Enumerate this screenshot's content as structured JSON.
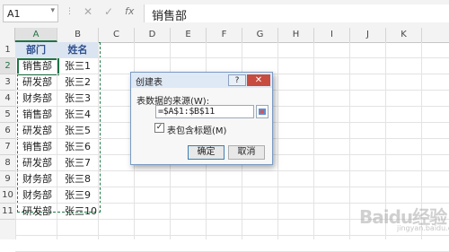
{
  "formula_bar": {
    "name_box": "A1",
    "name_box_arrow": "▾",
    "separator": "⋮",
    "cancel_symbol": "✕",
    "enter_symbol": "✓",
    "fx_label": "fx",
    "formula": "销售部"
  },
  "sheet": {
    "columns": [
      "A",
      "B",
      "C",
      "D",
      "E",
      "F",
      "G",
      "H",
      "I",
      "J",
      "K"
    ],
    "selected_column": "A",
    "rows": [
      "1",
      "2",
      "3",
      "4",
      "5",
      "6",
      "7",
      "8",
      "9",
      "10",
      "11"
    ],
    "selected_row": "2",
    "table_header": [
      "部门",
      "姓名"
    ],
    "table_rows": [
      [
        "销售部",
        "张三1"
      ],
      [
        "研发部",
        "张三2"
      ],
      [
        "财务部",
        "张三3"
      ],
      [
        "销售部",
        "张三4"
      ],
      [
        "研发部",
        "张三5"
      ],
      [
        "销售部",
        "张三6"
      ],
      [
        "研发部",
        "张三7"
      ],
      [
        "财务部",
        "张三8"
      ],
      [
        "财务部",
        "张三9"
      ],
      [
        "研发部",
        "张三10"
      ]
    ]
  },
  "dialog": {
    "title": "创建表",
    "help_label": "?",
    "close_label": "✕",
    "source_label": "表数据的来源(W):",
    "range_value": "=$A$1:$B$11",
    "checkbox_checked": true,
    "checkbox_mark": "✓",
    "checkbox_label": "表包含标题(M)",
    "ok_label": "确定",
    "cancel_label": "取消"
  },
  "watermark": {
    "text": "Baidu经验",
    "subtext": "jingyan.baidu.com"
  },
  "colors": {
    "accent_green": "#217346",
    "header_text": "#2f4f8f",
    "header_fill": "#dbe5f1"
  }
}
